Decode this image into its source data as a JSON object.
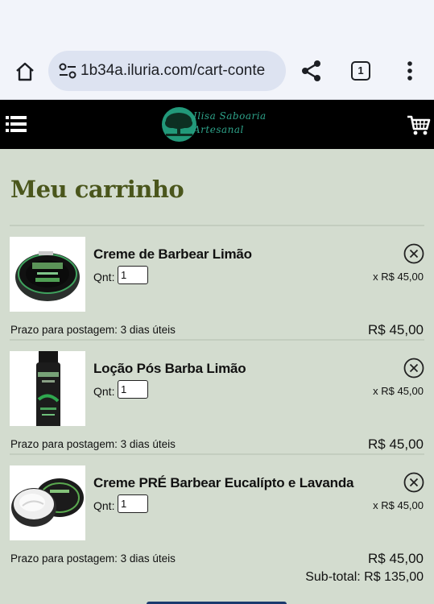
{
  "browser": {
    "url": "1b34a.iluria.com/cart-conte",
    "tab_count": "1"
  },
  "site": {
    "logo_line1": "Ilisa Saboaria",
    "logo_line2": "Artesanal"
  },
  "cart": {
    "title": "Meu carrinho",
    "qty_label": "Qnt:",
    "items": [
      {
        "name": "Creme de Barbear Limão",
        "qty": "1",
        "unit_price": "x R$ 45,00",
        "shipping": "Prazo para postagem: 3 dias úteis",
        "total": "R$ 45,00"
      },
      {
        "name": "Loção Pós Barba Limão",
        "qty": "1",
        "unit_price": "x R$ 45,00",
        "shipping": "Prazo para postagem: 3 dias úteis",
        "total": "R$ 45,00"
      },
      {
        "name": "Creme PRÉ Barbear Eucalípto e Lavanda",
        "qty": "1",
        "unit_price": "x R$ 45,00",
        "shipping": "Prazo para postagem: 3 dias úteis",
        "total": "R$ 45,00"
      }
    ],
    "subtotal": "Sub-total: R$ 135,00"
  },
  "colors": {
    "page_bg": "#d3dccf",
    "header_bg": "#000000",
    "title_green": "#4a561c",
    "logo_teal": "#22997a"
  }
}
